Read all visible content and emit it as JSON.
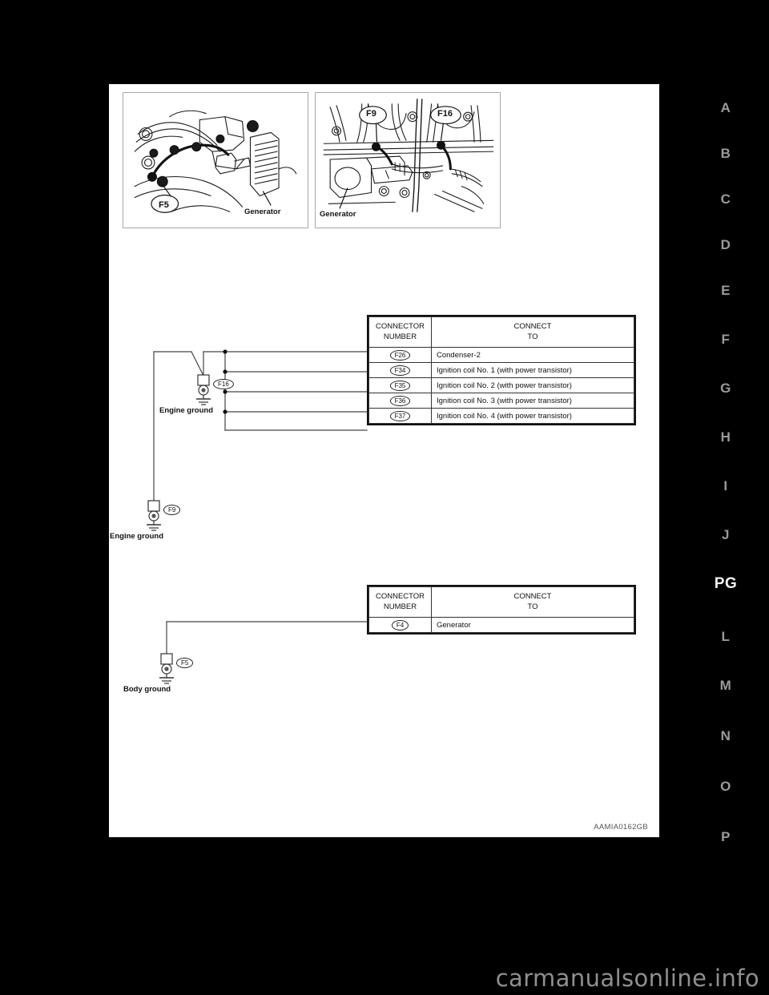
{
  "figure_id": "AAMIA0162GB",
  "watermark": "carmanualsonline.info",
  "side_tabs": [
    {
      "label": "A",
      "active": false
    },
    {
      "label": "B",
      "active": false
    },
    {
      "label": "C",
      "active": false
    },
    {
      "label": "D",
      "active": false
    },
    {
      "label": "E",
      "active": false
    },
    {
      "label": "F",
      "active": false
    },
    {
      "label": "G",
      "active": false
    },
    {
      "label": "H",
      "active": false
    },
    {
      "label": "I",
      "active": false
    },
    {
      "label": "J",
      "active": false
    },
    {
      "label": "PG",
      "active": true
    },
    {
      "label": "L",
      "active": false
    },
    {
      "label": "M",
      "active": false
    },
    {
      "label": "N",
      "active": false
    },
    {
      "label": "O",
      "active": false
    },
    {
      "label": "P",
      "active": false
    }
  ],
  "photos": {
    "left": {
      "callouts": [
        {
          "text": "F5"
        },
        {
          "text": "Generator"
        }
      ]
    },
    "right": {
      "callouts": [
        {
          "text": "F9"
        },
        {
          "text": "F16"
        },
        {
          "text": "Generator"
        }
      ]
    }
  },
  "tables": [
    {
      "headers": {
        "number": "CONNECTOR\nNUMBER",
        "number_line1": "CONNECTOR",
        "number_line2": "NUMBER",
        "to_line1": "CONNECT",
        "to_line2": "TO"
      },
      "rows": [
        {
          "number": "F26",
          "to": "Condenser-2"
        },
        {
          "number": "F34",
          "to": "Ignition coil No. 1 (with power transistor)"
        },
        {
          "number": "F35",
          "to": "Ignition coil No. 2 (with power transistor)"
        },
        {
          "number": "F36",
          "to": "Ignition coil No. 3 (with power transistor)"
        },
        {
          "number": "F37",
          "to": "Ignition coil No. 4 (with power transistor)"
        }
      ]
    },
    {
      "headers": {
        "number_line1": "CONNECTOR",
        "number_line2": "NUMBER",
        "to_line1": "CONNECT",
        "to_line2": "TO"
      },
      "rows": [
        {
          "number": "F4",
          "to": "Generator"
        }
      ]
    }
  ],
  "grounds": [
    {
      "badge": "F16",
      "label": "Engine ground"
    },
    {
      "badge": "F9",
      "label": "Engine ground"
    },
    {
      "badge": "F5",
      "label": "Body ground"
    }
  ],
  "colors": {
    "page_background": "#000000",
    "panel_background": "#ffffff",
    "ink": "#111111",
    "tab_inactive": "#9a9a9a",
    "tab_active": "#f2f2f2",
    "photo_border": "#a8a8a8"
  }
}
